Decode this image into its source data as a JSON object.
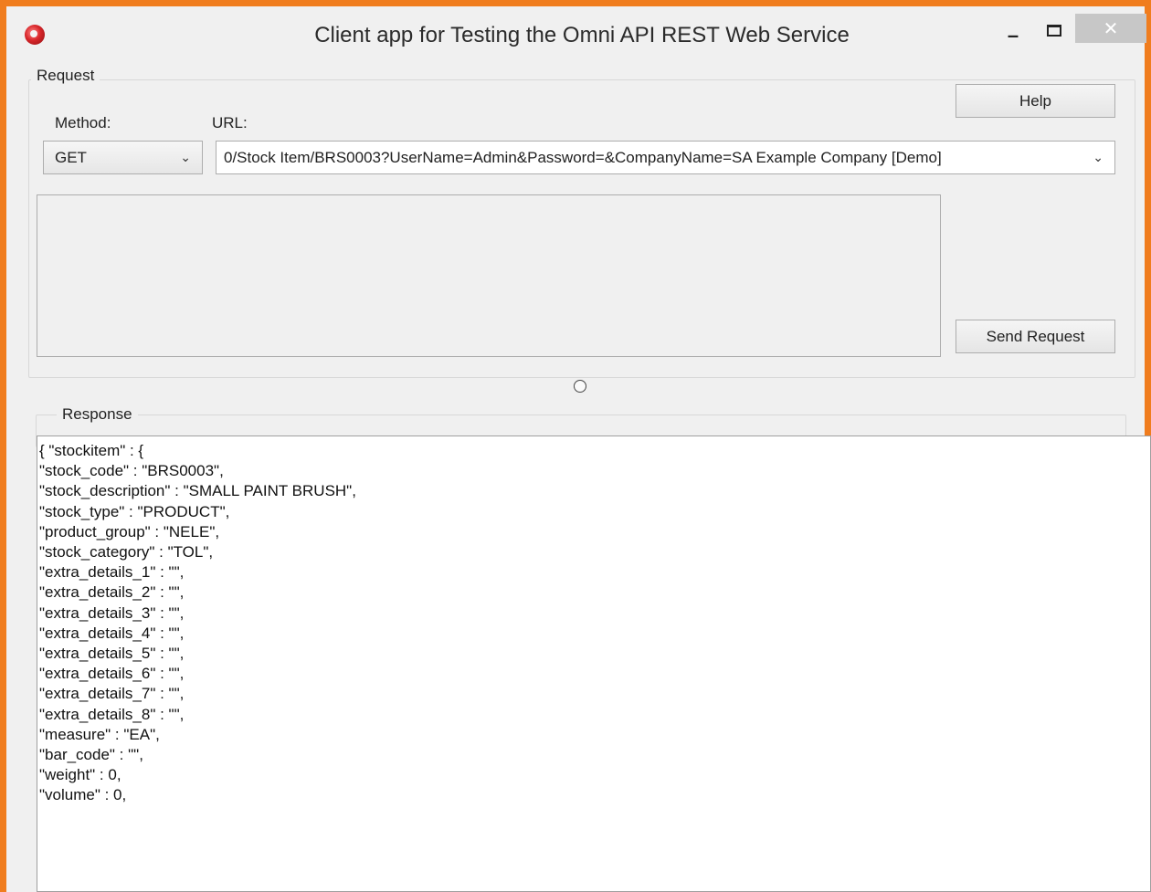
{
  "window": {
    "title": "Client app for Testing the Omni API REST Web Service",
    "controls": {
      "minimize": "–",
      "maximize": "",
      "close": "✕"
    },
    "accent_color": "#f07d1e"
  },
  "request": {
    "group_label": "Request",
    "method_label": "Method:",
    "url_label": "URL:",
    "method_value": "GET",
    "url_value": "0/Stock Item/BRS0003?UserName=Admin&Password=&CompanyName=SA Example Company [Demo]",
    "help_button": "Help",
    "send_button": "Send Request"
  },
  "response": {
    "group_label": "Response",
    "lines": [
      "{ \"stockitem\" : {",
      "\"stock_code\" : \"BRS0003\",",
      "\"stock_description\" : \"SMALL PAINT BRUSH\",",
      "\"stock_type\" : \"PRODUCT\",",
      "\"product_group\" : \"NELE\",",
      "\"stock_category\" : \"TOL\",",
      "\"extra_details_1\" : \"\",",
      "\"extra_details_2\" : \"\",",
      "\"extra_details_3\" : \"\",",
      "\"extra_details_4\" : \"\",",
      "\"extra_details_5\" : \"\",",
      "\"extra_details_6\" : \"\",",
      "\"extra_details_7\" : \"\",",
      "\"extra_details_8\" : \"\",",
      "\"measure\" : \"EA\",",
      "\"bar_code\" : \"\",",
      "\"weight\" : 0,",
      "\"volume\" : 0,"
    ]
  },
  "icons": {
    "app": "app-logo-icon",
    "dropdown": "chevron-down-icon",
    "splitter": "splitter-radio-icon"
  }
}
